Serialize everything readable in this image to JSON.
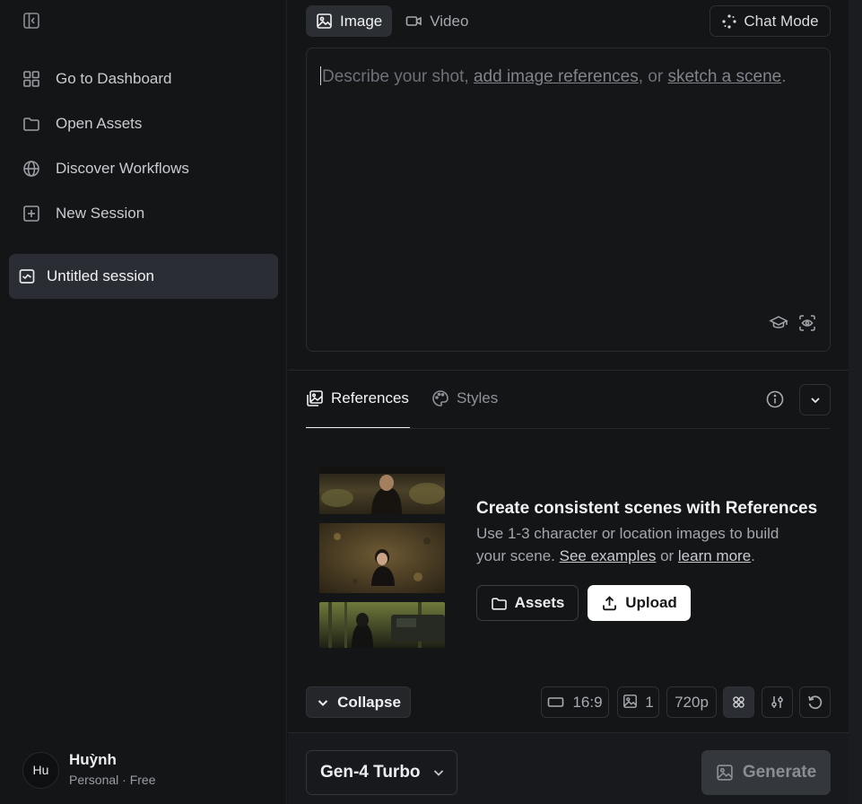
{
  "sidebar": {
    "items": [
      {
        "label": "Go to Dashboard",
        "icon": "grid-icon"
      },
      {
        "label": "Open Assets",
        "icon": "folder-icon"
      },
      {
        "label": "Discover Workflows",
        "icon": "globe-icon"
      },
      {
        "label": "New Session",
        "icon": "plus-square-icon"
      }
    ],
    "session": {
      "label": "Untitled session"
    },
    "user": {
      "initials": "Hu",
      "name": "Huỳnh",
      "plan": "Personal · Free"
    }
  },
  "mode_tabs": [
    {
      "label": "Image",
      "active": true
    },
    {
      "label": "Video",
      "active": false
    }
  ],
  "chat_mode": {
    "label": "Chat Mode"
  },
  "prompt": {
    "part1": "Describe your shot, ",
    "link1": "add image references",
    "part2": ", or ",
    "link2": "sketch a scene",
    "part3": "."
  },
  "ref_tabs": [
    {
      "label": "References",
      "active": true
    },
    {
      "label": "Styles",
      "active": false
    }
  ],
  "references": {
    "title": "Create consistent scenes with References",
    "desc1": "Use 1-3 character or location images to build your scene. ",
    "link1": "See examples",
    "desc2": " or ",
    "link2": "learn more",
    "desc3": ".",
    "assets_label": "Assets",
    "upload_label": "Upload"
  },
  "controls": {
    "collapse_label": "Collapse",
    "aspect_ratio": "16:9",
    "image_count": "1",
    "resolution": "720p"
  },
  "footer": {
    "model": "Gen-4 Turbo",
    "generate_label": "Generate"
  },
  "colors": {
    "background": "#141517",
    "active_tab_bg": "#2b2e33",
    "upload_bg": "#ffffff",
    "generate_bg": "#34373c"
  }
}
